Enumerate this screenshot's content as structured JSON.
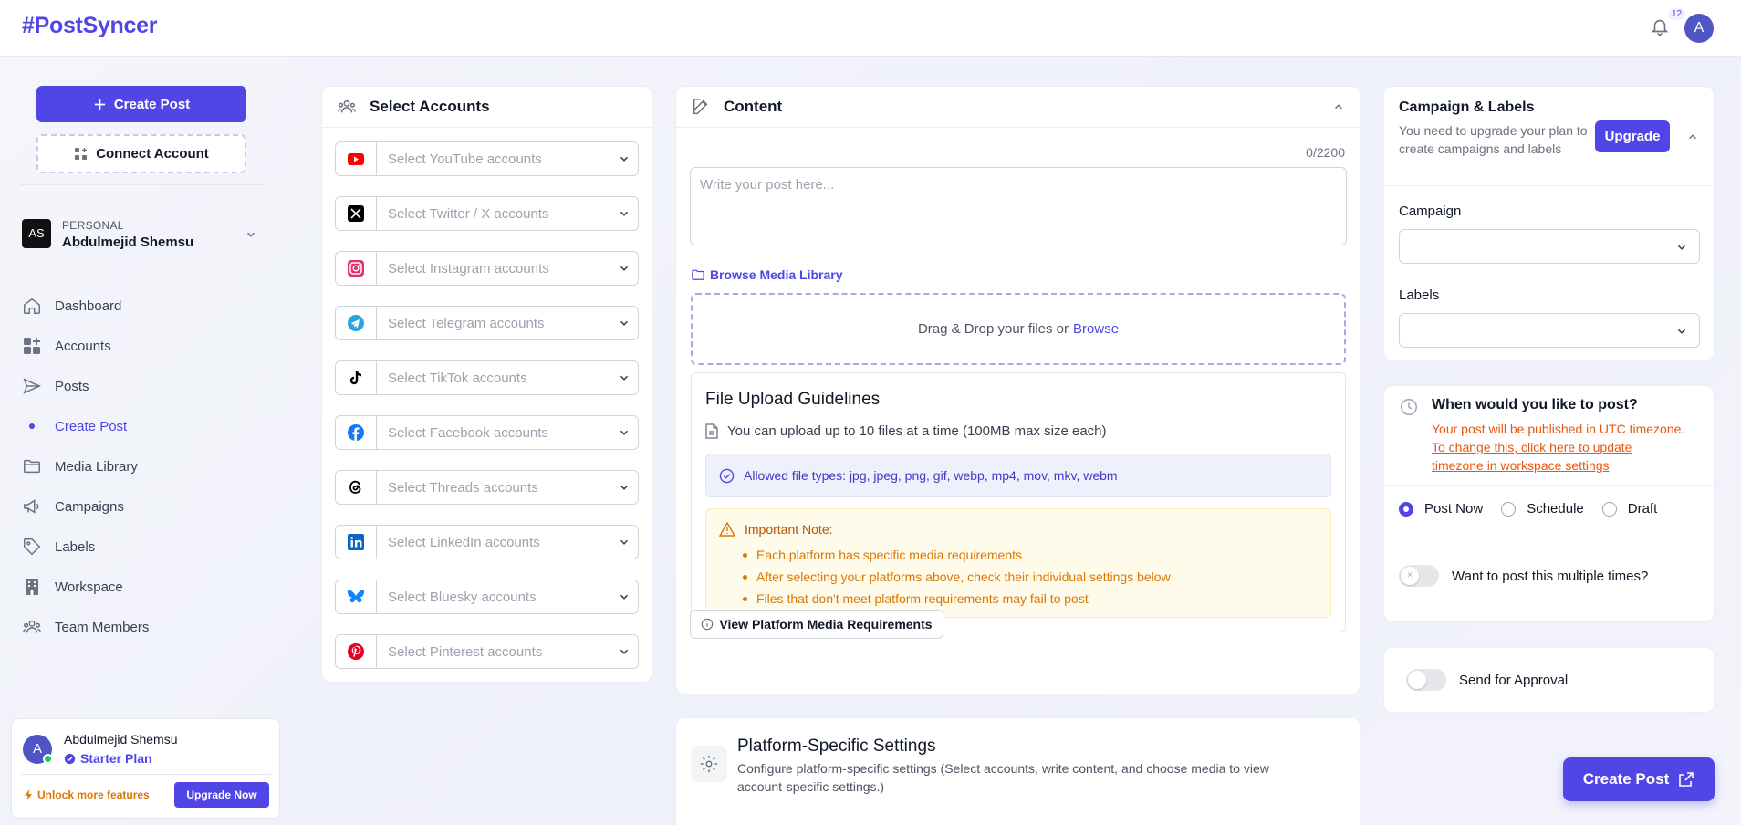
{
  "app": {
    "logo": "#PostSyncer",
    "notification_count": "12",
    "avatar_initial": "A"
  },
  "sidebar": {
    "create_post_label": "Create Post",
    "connect_account_label": "Connect Account",
    "workspace": {
      "initials": "AS",
      "kind": "PERSONAL",
      "name": "Abdulmejid Shemsu"
    },
    "nav": [
      {
        "label": "Dashboard",
        "icon": "home-icon"
      },
      {
        "label": "Accounts",
        "icon": "grid-icon"
      },
      {
        "label": "Posts",
        "icon": "send-icon"
      },
      {
        "label": "Create Post",
        "icon": "dot-icon",
        "active": true
      },
      {
        "label": "Media Library",
        "icon": "folder-icon"
      },
      {
        "label": "Campaigns",
        "icon": "megaphone-icon"
      },
      {
        "label": "Labels",
        "icon": "tag-icon"
      },
      {
        "label": "Workspace",
        "icon": "building-icon"
      },
      {
        "label": "Team Members",
        "icon": "users-icon"
      }
    ],
    "user": {
      "initial": "A",
      "name": "Abdulmejid Shemsu",
      "plan": "Starter Plan",
      "unlock": "Unlock more features",
      "upgrade": "Upgrade Now"
    }
  },
  "accounts": {
    "title": "Select Accounts",
    "rows": [
      {
        "label": "Select YouTube accounts",
        "icon": "youtube-icon",
        "color": "#ff0000"
      },
      {
        "label": "Select Twitter / X accounts",
        "icon": "x-icon",
        "color": "#000000"
      },
      {
        "label": "Select Instagram accounts",
        "icon": "instagram-icon",
        "color": "#e1306c"
      },
      {
        "label": "Select Telegram accounts",
        "icon": "telegram-icon",
        "color": "#2aa3df"
      },
      {
        "label": "Select TikTok accounts",
        "icon": "tiktok-icon",
        "color": "#000000"
      },
      {
        "label": "Select Facebook accounts",
        "icon": "facebook-icon",
        "color": "#1877f2"
      },
      {
        "label": "Select Threads accounts",
        "icon": "threads-icon",
        "color": "#000000"
      },
      {
        "label": "Select LinkedIn accounts",
        "icon": "linkedin-icon",
        "color": "#0a66c2"
      },
      {
        "label": "Select Bluesky accounts",
        "icon": "bluesky-icon",
        "color": "#1185fe"
      },
      {
        "label": "Select Pinterest accounts",
        "icon": "pinterest-icon",
        "color": "#e60023"
      }
    ]
  },
  "content": {
    "title": "Content",
    "counter": "0/2200",
    "placeholder": "Write your post here...",
    "browse_library": "Browse Media Library",
    "dropzone_text": "Drag & Drop your files or",
    "dropzone_link": "Browse",
    "guidelines": {
      "title": "File Upload Guidelines",
      "limit": "You can upload up to 10 files at a time (100MB max size each)",
      "allowed": "Allowed file types: jpg, jpeg, png, gif, webp, mp4, mov, mkv, webm",
      "note_title": "Important Note:",
      "notes": [
        "Each platform has specific media requirements",
        "After selecting your platforms above, check their individual settings below",
        "Files that don't meet platform requirements may fail to post"
      ]
    },
    "view_requirements": "View Platform Media Requirements"
  },
  "platform_settings": {
    "title": "Platform-Specific Settings",
    "description": "Configure platform-specific settings (Select accounts, write content, and choose media to view account-specific settings.)"
  },
  "campaign": {
    "title": "Campaign & Labels",
    "subtitle": "You need to upgrade your plan to create campaigns and labels",
    "upgrade": "Upgrade",
    "campaign_label": "Campaign",
    "labels_label": "Labels"
  },
  "schedule": {
    "title": "When would you like to post?",
    "notice": "Your post will be published in UTC timezone.",
    "notice_link": "To change this, click here to update timezone in workspace settings",
    "options": [
      "Post Now",
      "Schedule",
      "Draft"
    ],
    "selected": "Post Now",
    "multiple": "Want to post this multiple times?"
  },
  "approval": {
    "label": "Send for Approval"
  },
  "fab": {
    "label": "Create Post"
  },
  "colors": {
    "accent": "#4f46e5",
    "warning": "#d97706",
    "link_orange": "#ea580c"
  }
}
